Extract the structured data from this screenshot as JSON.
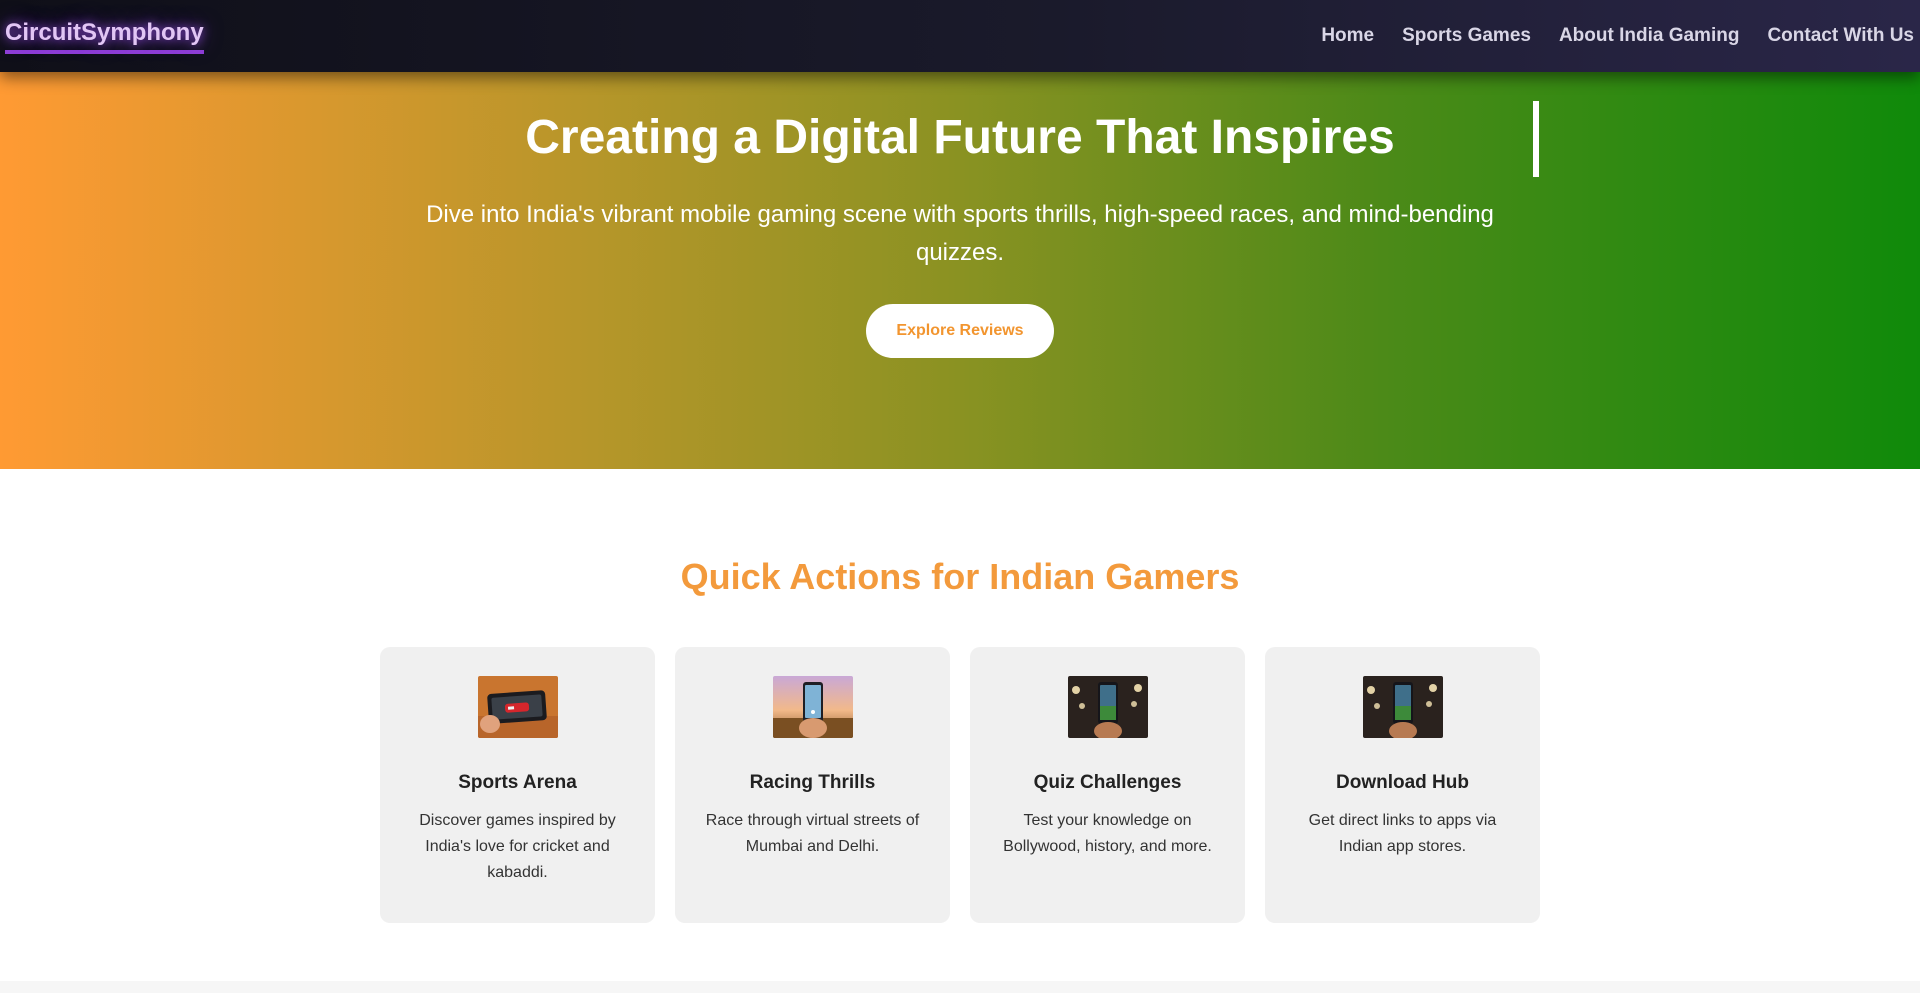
{
  "header": {
    "logo": "CircuitSymphony",
    "nav": [
      "Home",
      "Sports Games",
      "About India Gaming",
      "Contact With Us"
    ]
  },
  "hero": {
    "title": "Creating a Digital Future That Inspires",
    "subtitle": "Dive into India's vibrant mobile gaming scene with sports thrills, high-speed races, and mind-bending quizzes.",
    "button": "Explore Reviews"
  },
  "quick_actions": {
    "title": "Quick Actions for Indian Gamers",
    "cards": [
      {
        "title": "Sports Arena",
        "desc": "Discover games inspired by India's love for cricket and kabaddi.",
        "image": "phone-racing-game-image"
      },
      {
        "title": "Racing Thrills",
        "desc": "Race through virtual streets of Mumbai and Delhi.",
        "image": "phone-sunset-field-image"
      },
      {
        "title": "Quiz Challenges",
        "desc": "Test your knowledge on Bollywood, history, and more.",
        "image": "phone-stadium-lights-image"
      },
      {
        "title": "Download Hub",
        "desc": "Get direct links to apps via Indian app stores.",
        "image": "phone-stadium-lights-image"
      }
    ]
  },
  "colors": {
    "accent": "#f39a3c",
    "logo_underline": "#8f3fd6",
    "hero_start": "#ff9a33",
    "hero_end": "#0f8a0a",
    "nav_bg": "#14141f"
  }
}
